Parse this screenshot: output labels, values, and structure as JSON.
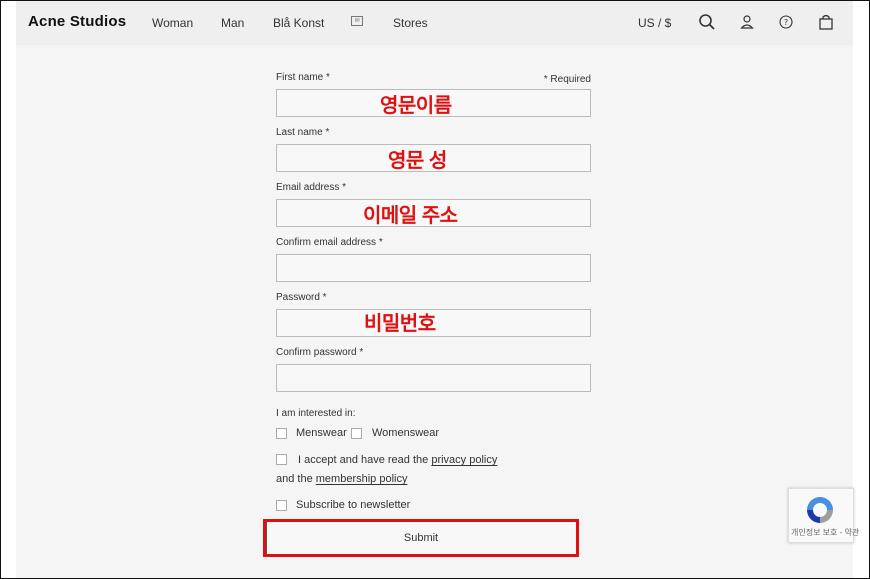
{
  "nav": {
    "brand": "Acne Studios",
    "links": [
      "Woman",
      "Man",
      "Blå Konst",
      "Stores"
    ],
    "box_icon_label": "✉",
    "currency": "US / $",
    "icons": [
      "search-icon",
      "account-icon",
      "help-icon",
      "bag-icon"
    ]
  },
  "form": {
    "required_note": "* Required",
    "fields": [
      {
        "label": "First name *",
        "annotation": "영문이름"
      },
      {
        "label": "Last name *",
        "annotation": "영문 성"
      },
      {
        "label": "Email address *",
        "annotation": "이메일 주소"
      },
      {
        "label": "Confirm email address *",
        "annotation": ""
      },
      {
        "label": "Password *",
        "annotation": "비밀번호"
      },
      {
        "label": "Confirm password *",
        "annotation": ""
      }
    ],
    "interested_label": "I am interested in:",
    "menswear": "Menswear",
    "womenswear": "Womenswear",
    "accept_text": "I accept and have read the",
    "privacy_link": "privacy policy",
    "and_the": "and the",
    "membership_link": "membership policy",
    "newsletter": "Subscribe to newsletter",
    "submit": "Submit"
  },
  "recaptcha": {
    "text": "개인정보 보호 - 약관"
  },
  "colors": {
    "annotation": "#e01010",
    "nav_bg": "#efefef",
    "page_bg": "#f5f5f5"
  }
}
